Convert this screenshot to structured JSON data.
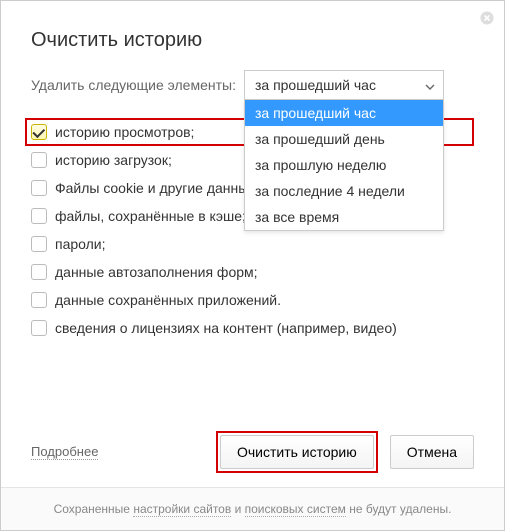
{
  "title": "Очистить историю",
  "time_label": "Удалить следующие элементы:",
  "selected_option": "за прошедший час",
  "dropdown": [
    {
      "label": "за прошедший час",
      "selected": true
    },
    {
      "label": "за прошедший день",
      "selected": false
    },
    {
      "label": "за прошлую неделю",
      "selected": false
    },
    {
      "label": "за последние 4 недели",
      "selected": false
    },
    {
      "label": "за все время",
      "selected": false
    }
  ],
  "items": [
    {
      "label": "историю просмотров;",
      "checked": true,
      "highlight": true
    },
    {
      "label": "историю загрузок;",
      "checked": false,
      "highlight": false
    },
    {
      "label": "Файлы cookie и другие данные сайтов и модулей",
      "checked": false,
      "highlight": false
    },
    {
      "label": "файлы, сохранённые в кэше;",
      "checked": false,
      "highlight": false
    },
    {
      "label": "пароли;",
      "checked": false,
      "highlight": false
    },
    {
      "label": "данные автозаполнения форм;",
      "checked": false,
      "highlight": false
    },
    {
      "label": "данные сохранённых приложений.",
      "checked": false,
      "highlight": false
    },
    {
      "label": "сведения о лицензиях на контент (например, видео)",
      "checked": false,
      "highlight": false
    }
  ],
  "more": "Подробнее",
  "primary_btn": "Очистить историю",
  "cancel_btn": "Отмена",
  "info": {
    "prefix": "Сохраненные ",
    "link1": "настройки сайтов",
    "mid": " и ",
    "link2": "поисковых систем",
    "suffix": " не будут удалены."
  }
}
